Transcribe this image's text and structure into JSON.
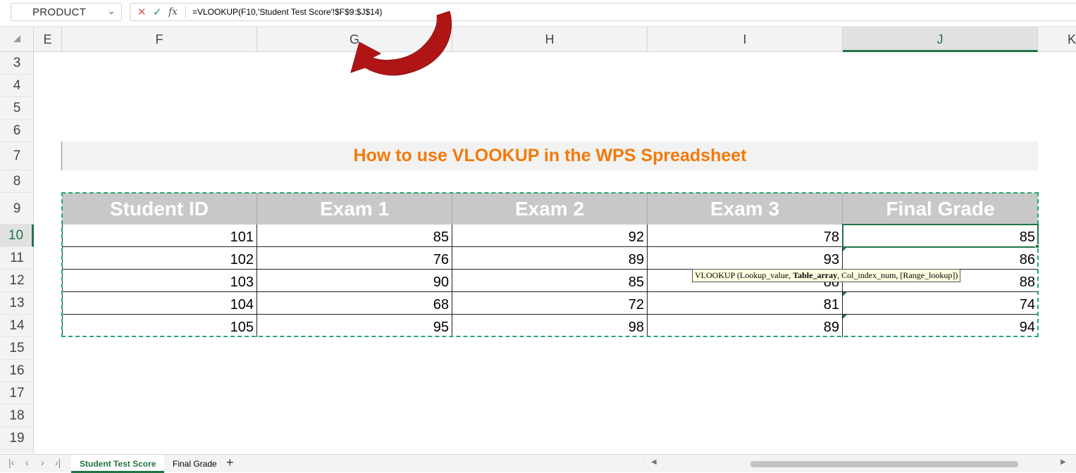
{
  "formula_bar": {
    "name_box": "PRODUCT",
    "formula": "=VLOOKUP(F10,'Student Test Score'!$F$9:$J$14)"
  },
  "columns": [
    "E",
    "F",
    "G",
    "H",
    "I",
    "J",
    "K"
  ],
  "rows": [
    "3",
    "4",
    "5",
    "6",
    "7",
    "8",
    "9",
    "10",
    "11",
    "12",
    "13",
    "14",
    "15",
    "16",
    "17",
    "18",
    "19"
  ],
  "sheet": {
    "title": "How to use VLOOKUP in the WPS Spreadsheet",
    "table": {
      "headers": [
        "Student ID",
        "Exam 1",
        "Exam 2",
        "Exam 3",
        "Final Grade"
      ],
      "rows": [
        [
          "101",
          "85",
          "92",
          "78",
          "85"
        ],
        [
          "102",
          "76",
          "89",
          "93",
          "86"
        ],
        [
          "103",
          "90",
          "85",
          "88",
          "88"
        ],
        [
          "104",
          "68",
          "72",
          "81",
          "74"
        ],
        [
          "105",
          "95",
          "98",
          "89",
          "94"
        ]
      ]
    }
  },
  "tooltip": {
    "prefix": "VLOOKUP (Lookup_value, ",
    "bold": "Table_array",
    "suffix": ", Col_index_num, [Range_lookup])"
  },
  "tabs": [
    "Student Test Score",
    "Final Grade"
  ],
  "icons": {
    "cancel": "close-icon",
    "enter": "check-icon",
    "function": "fx-icon",
    "annotation": "curved-arrow-icon"
  },
  "colors": {
    "accent": "#217346",
    "title": "#f4790a",
    "header_fill": "#c8c8c8",
    "marquee": "#27a86c",
    "arrow": "#b01515"
  }
}
